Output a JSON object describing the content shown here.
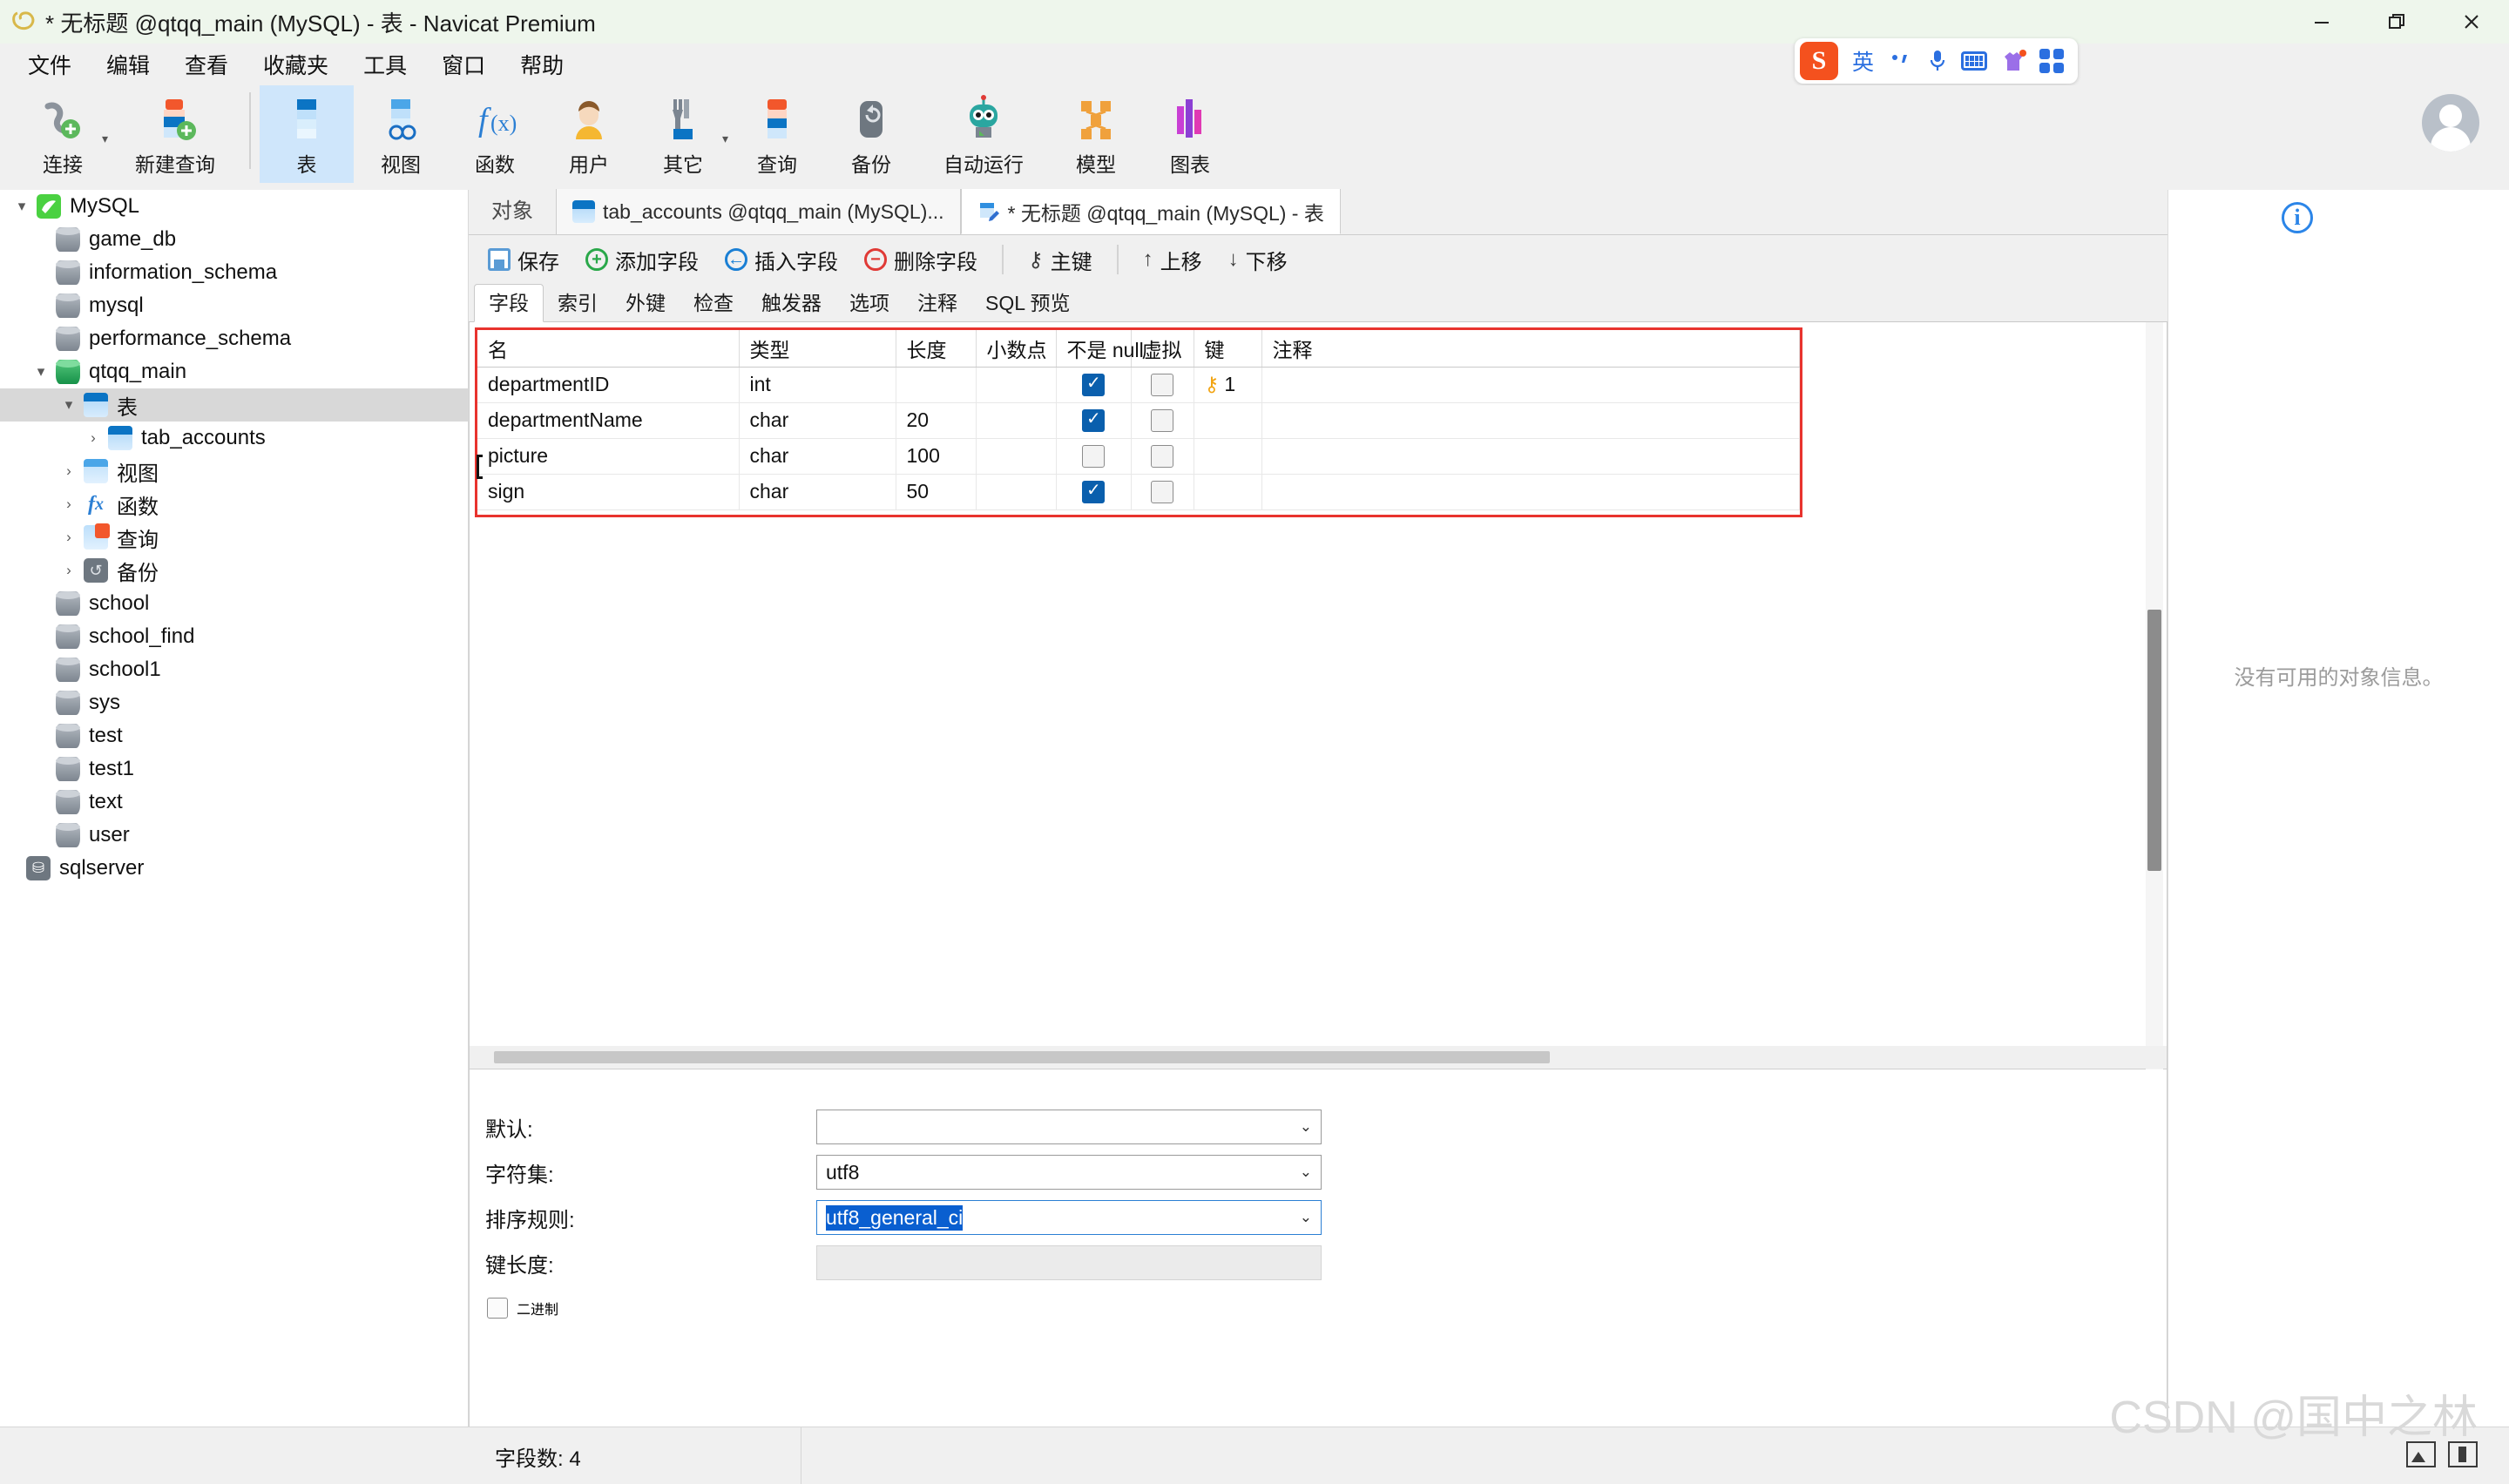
{
  "window": {
    "title": "* 无标题 @qtqq_main (MySQL) - 表 - Navicat Premium",
    "minimize": "—",
    "restore": "❐",
    "close": "✕"
  },
  "menubar": {
    "items": [
      {
        "label": "文件",
        "name": "menu-file"
      },
      {
        "label": "编辑",
        "name": "menu-edit"
      },
      {
        "label": "查看",
        "name": "menu-view"
      },
      {
        "label": "收藏夹",
        "name": "menu-favorites"
      },
      {
        "label": "工具",
        "name": "menu-tools"
      },
      {
        "label": "窗口",
        "name": "menu-window"
      },
      {
        "label": "帮助",
        "name": "menu-help"
      }
    ]
  },
  "ime": {
    "logo": "S",
    "mode": "英",
    "punct": "，",
    "mic": "mic-icon",
    "keyboard": "keyboard-icon",
    "skin": "skin-icon",
    "apps": "apps-icon"
  },
  "ribbon": {
    "items": [
      {
        "label": "连接",
        "icon": "connection-icon",
        "dropdown": true,
        "active": false
      },
      {
        "label": "新建查询",
        "icon": "new-query-icon",
        "dropdown": false,
        "active": false
      },
      {
        "label": "表",
        "icon": "table-icon",
        "dropdown": false,
        "active": true
      },
      {
        "label": "视图",
        "icon": "view-icon",
        "dropdown": false,
        "active": false
      },
      {
        "label": "函数",
        "icon": "function-icon",
        "dropdown": false,
        "active": false
      },
      {
        "label": "用户",
        "icon": "user-icon",
        "dropdown": false,
        "active": false
      },
      {
        "label": "其它",
        "icon": "other-icon",
        "dropdown": true,
        "active": false
      },
      {
        "label": "查询",
        "icon": "query-icon",
        "dropdown": false,
        "active": false
      },
      {
        "label": "备份",
        "icon": "backup-icon",
        "dropdown": false,
        "active": false
      },
      {
        "label": "自动运行",
        "icon": "automation-icon",
        "dropdown": false,
        "active": false
      },
      {
        "label": "模型",
        "icon": "model-icon",
        "dropdown": false,
        "active": false
      },
      {
        "label": "图表",
        "icon": "chart-icon",
        "dropdown": false,
        "active": false
      }
    ]
  },
  "sidebar": {
    "nodes": [
      {
        "label": "MySQL",
        "indent": 0,
        "arrow": "▾",
        "icon": "mysql-icon",
        "selected": false
      },
      {
        "label": "game_db",
        "indent": 1,
        "arrow": "",
        "icon": "db-icon",
        "selected": false
      },
      {
        "label": "information_schema",
        "indent": 1,
        "arrow": "",
        "icon": "db-icon",
        "selected": false
      },
      {
        "label": "mysql",
        "indent": 1,
        "arrow": "",
        "icon": "db-icon",
        "selected": false
      },
      {
        "label": "performance_schema",
        "indent": 1,
        "arrow": "",
        "icon": "db-icon",
        "selected": false
      },
      {
        "label": "qtqq_main",
        "indent": 1,
        "arrow": "▾",
        "icon": "db-active-icon",
        "selected": false
      },
      {
        "label": "表",
        "indent": 2,
        "arrow": "▾",
        "icon": "table-icon",
        "selected": true
      },
      {
        "label": "tab_accounts",
        "indent": 3,
        "arrow": "›",
        "icon": "table-icon",
        "selected": false
      },
      {
        "label": "视图",
        "indent": 2,
        "arrow": "›",
        "icon": "view-icon",
        "selected": false
      },
      {
        "label": "函数",
        "indent": 2,
        "arrow": "›",
        "icon": "function-icon",
        "selected": false
      },
      {
        "label": "查询",
        "indent": 2,
        "arrow": "›",
        "icon": "query-icon",
        "selected": false
      },
      {
        "label": "备份",
        "indent": 2,
        "arrow": "›",
        "icon": "backup-icon",
        "selected": false
      },
      {
        "label": "school",
        "indent": 1,
        "arrow": "",
        "icon": "db-icon",
        "selected": false
      },
      {
        "label": "school_find",
        "indent": 1,
        "arrow": "",
        "icon": "db-icon",
        "selected": false
      },
      {
        "label": "school1",
        "indent": 1,
        "arrow": "",
        "icon": "db-icon",
        "selected": false
      },
      {
        "label": "sys",
        "indent": 1,
        "arrow": "",
        "icon": "db-icon",
        "selected": false
      },
      {
        "label": "test",
        "indent": 1,
        "arrow": "",
        "icon": "db-icon",
        "selected": false
      },
      {
        "label": "test1",
        "indent": 1,
        "arrow": "",
        "icon": "db-icon",
        "selected": false
      },
      {
        "label": "text",
        "indent": 1,
        "arrow": "",
        "icon": "db-icon",
        "selected": false
      },
      {
        "label": "user",
        "indent": 1,
        "arrow": "",
        "icon": "db-icon",
        "selected": false
      },
      {
        "label": "sqlserver",
        "indent": 0,
        "arrow": "",
        "icon": "sqlserver-icon",
        "selected": false
      }
    ]
  },
  "tabstrip": {
    "object_label": "对象",
    "tabs": [
      {
        "label": "tab_accounts @qtqq_main (MySQL)...",
        "active": false,
        "icon": "table-tab-icon"
      },
      {
        "label": "* 无标题 @qtqq_main (MySQL) - 表",
        "active": true,
        "icon": "table-edit-tab-icon"
      }
    ]
  },
  "actions": [
    {
      "label": "保存",
      "icon": "save-icon",
      "name": "save-button"
    },
    {
      "label": "添加字段",
      "icon": "add-field-icon",
      "name": "add-field-button"
    },
    {
      "label": "插入字段",
      "icon": "insert-field-icon",
      "name": "insert-field-button"
    },
    {
      "label": "删除字段",
      "icon": "delete-field-icon",
      "name": "delete-field-button"
    },
    {
      "label": "主键",
      "icon": "primary-key-icon",
      "name": "primary-key-button"
    },
    {
      "label": "上移",
      "icon": "arrow-up-icon",
      "name": "move-up-button"
    },
    {
      "label": "下移",
      "icon": "arrow-down-icon",
      "name": "move-down-button"
    }
  ],
  "subtabs": [
    {
      "label": "字段",
      "active": true
    },
    {
      "label": "索引",
      "active": false
    },
    {
      "label": "外键",
      "active": false
    },
    {
      "label": "检查",
      "active": false
    },
    {
      "label": "触发器",
      "active": false
    },
    {
      "label": "选项",
      "active": false
    },
    {
      "label": "注释",
      "active": false
    },
    {
      "label": "SQL 预览",
      "active": false
    }
  ],
  "grid": {
    "columns": [
      "名",
      "类型",
      "长度",
      "小数点",
      "不是 null",
      "虚拟",
      "键",
      "注释"
    ],
    "rows": [
      {
        "name": "departmentID",
        "type": "int",
        "length": "",
        "decimals": "",
        "not_null": true,
        "virtual": false,
        "key": "1",
        "comment": ""
      },
      {
        "name": "departmentName",
        "type": "char",
        "length": "20",
        "decimals": "",
        "not_null": true,
        "virtual": false,
        "key": "",
        "comment": ""
      },
      {
        "name": "picture",
        "type": "char",
        "length": "100",
        "decimals": "",
        "not_null": false,
        "virtual": false,
        "key": "",
        "comment": ""
      },
      {
        "name": "sign",
        "type": "char",
        "length": "50",
        "decimals": "",
        "not_null": true,
        "virtual": false,
        "key": "",
        "comment": ""
      }
    ]
  },
  "form": {
    "default_label": "默认:",
    "default_value": "",
    "charset_label": "字符集:",
    "charset_value": "utf8",
    "collation_label": "排序规则:",
    "collation_value": "utf8_general_ci",
    "keylength_label": "键长度:",
    "keylength_value": "",
    "binary_label": "二进制",
    "binary_checked": false
  },
  "right_panel": {
    "info_icon": "info-icon",
    "empty_message": "没有可用的对象信息。"
  },
  "statusbar": {
    "field_count": "字段数: 4"
  },
  "watermark": "CSDN @国中之林",
  "colors": {
    "accent": "#0a5fad",
    "titlebar": "#eef6ec",
    "highlight_box": "#e8332e",
    "selection": "#0a5fd0"
  }
}
